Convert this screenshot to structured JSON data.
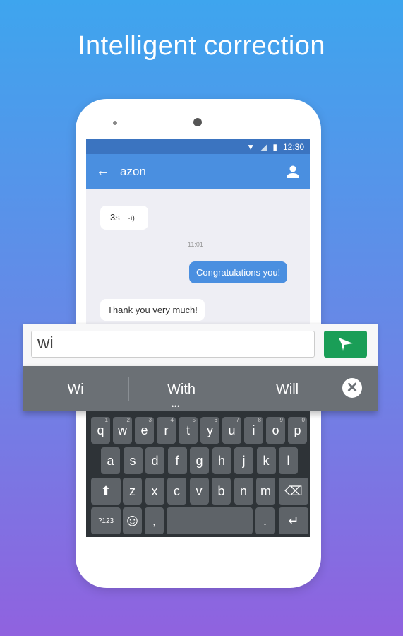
{
  "headline": "Intelligent correction",
  "status": {
    "time": "12:30",
    "icons": [
      "wifi-icon",
      "signal-icon",
      "battery-icon"
    ]
  },
  "appbar": {
    "title": "azon",
    "back_icon": "arrow-left-icon",
    "profile_icon": "person-icon"
  },
  "chat": {
    "voice_msg": "3s",
    "timestamp": "11:01",
    "outgoing": "Congratulations you!",
    "incoming": "Thank you very much!"
  },
  "input": {
    "value": "wi",
    "send_icon": "paper-plane-icon"
  },
  "suggestions": [
    "Wi",
    "With",
    "Will"
  ],
  "more_dots": "•••",
  "close_label": "✕",
  "keyboard": {
    "row1": [
      "q",
      "w",
      "e",
      "r",
      "t",
      "y",
      "u",
      "i",
      "o",
      "p"
    ],
    "row1_nums": [
      "1",
      "2",
      "3",
      "4",
      "5",
      "6",
      "7",
      "8",
      "9",
      "0"
    ],
    "row2": [
      "a",
      "s",
      "d",
      "f",
      "g",
      "h",
      "j",
      "k",
      "l"
    ],
    "row3": [
      "z",
      "x",
      "c",
      "v",
      "b",
      "n",
      "m"
    ],
    "symbols_label": "?123",
    "comma": ",",
    "period": ".",
    "colors": {
      "key": "#5e6368",
      "background": "#2e3337"
    }
  },
  "colors": {
    "accent": "#4a8fe0",
    "send": "#1a9e57",
    "status_bar": "#3b74c0"
  }
}
